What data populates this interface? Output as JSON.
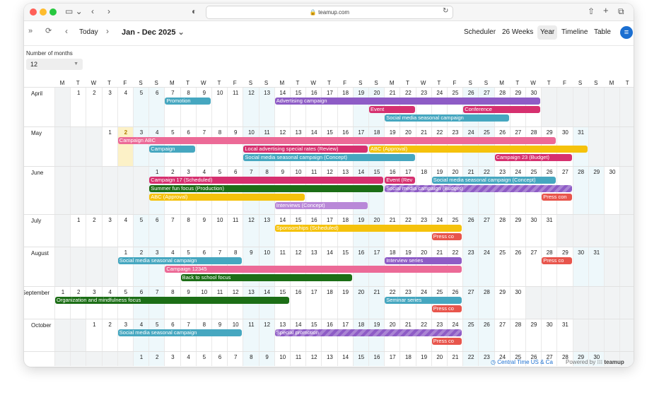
{
  "browser": {
    "url": "teamup.com"
  },
  "toolbar": {
    "today": "Today",
    "range_title": "Jan - Dec 2025",
    "views": [
      "Scheduler",
      "26 Weeks",
      "Year",
      "Timeline",
      "Table"
    ],
    "active_view": "Year"
  },
  "filters": {
    "label": "Number of months",
    "value": "12"
  },
  "weekday_header": [
    "M",
    "T",
    "W",
    "T",
    "F",
    "S",
    "S",
    "M",
    "T",
    "W",
    "T",
    "F",
    "S",
    "S",
    "M",
    "T",
    "W",
    "T",
    "F",
    "S",
    "S",
    "M",
    "T",
    "W",
    "T",
    "F",
    "S",
    "S",
    "M",
    "T",
    "W",
    "T",
    "F",
    "S",
    "S",
    "M",
    "T"
  ],
  "colors": {
    "violet": "#8e5cc6",
    "teal": "#46a7c0",
    "magenta": "#d6306f",
    "pink": "#ec6a97",
    "yellow": "#f5c20c",
    "green": "#1c6e16",
    "lilac": "#b988d8",
    "red": "#e8554c"
  },
  "months": [
    {
      "name": "April",
      "offset": 1,
      "days": 30,
      "height": 56,
      "events": [
        {
          "text": "Promotion",
          "start": 7,
          "end": 9,
          "lane": 0,
          "color": "teal"
        },
        {
          "text": "Advertising campaign",
          "start": 14,
          "end": 30,
          "lane": 0,
          "color": "violet"
        },
        {
          "text": "Event",
          "start": 20,
          "end": 22,
          "lane": 1,
          "color": "magenta"
        },
        {
          "text": "Conference",
          "start": 26,
          "end": 30,
          "lane": 1,
          "color": "magenta"
        },
        {
          "text": "Social media seasonal campaign",
          "start": 21,
          "end": 28,
          "lane": 2,
          "color": "teal"
        }
      ]
    },
    {
      "name": "May",
      "offset": 3,
      "days": 31,
      "height": 56,
      "today": 2,
      "events": [
        {
          "text": "Campaign ABC",
          "start": 2,
          "end": 29,
          "lane": 0,
          "color": "pink"
        },
        {
          "text": "Campaign",
          "start": 4,
          "end": 6,
          "lane": 1,
          "color": "teal"
        },
        {
          "text": "Local advertising special rates (Review)",
          "start": 10,
          "end": 17,
          "lane": 1,
          "color": "magenta"
        },
        {
          "text": "ABC (Approval)",
          "start": 18,
          "end": 31,
          "lane": 1,
          "color": "yellow"
        },
        {
          "text": "Social media seasonal campaign (Concept)",
          "start": 10,
          "end": 20,
          "lane": 2,
          "color": "teal"
        },
        {
          "text": "Campaign 23 (Budget)",
          "start": 26,
          "end": 30,
          "lane": 2,
          "color": "magenta"
        }
      ]
    },
    {
      "name": "June",
      "offset": 6,
      "days": 30,
      "height": 68,
      "events": [
        {
          "text": "Campaign 17 (Scheduled)",
          "start": 1,
          "end": 15,
          "lane": 0,
          "color": "magenta"
        },
        {
          "text": "Event (Rev",
          "start": 16,
          "end": 17,
          "lane": 0,
          "color": "magenta"
        },
        {
          "text": "Social media seasonal campaign (Concept)",
          "start": 19,
          "end": 26,
          "lane": 0,
          "color": "teal"
        },
        {
          "text": "Summer fun focus (Production)",
          "start": 1,
          "end": 15,
          "lane": 1,
          "color": "green"
        },
        {
          "text": "Social media campaign (Budget)",
          "start": 16,
          "end": 27,
          "lane": 1,
          "color": "violet",
          "stripe": true
        },
        {
          "text": "ABC (Approval)",
          "start": 1,
          "end": 10,
          "lane": 2,
          "color": "yellow"
        },
        {
          "text": "Press con",
          "start": 26,
          "end": 27,
          "lane": 2,
          "color": "red"
        },
        {
          "text": "Interviews (Concept)",
          "start": 9,
          "end": 14,
          "lane": 3,
          "color": "lilac"
        }
      ]
    },
    {
      "name": "July",
      "offset": 1,
      "days": 31,
      "height": 46,
      "events": [
        {
          "text": "Sponsorships (Scheduled)",
          "start": 14,
          "end": 25,
          "lane": 0,
          "color": "yellow"
        },
        {
          "text": "Press co",
          "start": 24,
          "end": 25,
          "lane": 1,
          "color": "red"
        }
      ]
    },
    {
      "name": "August",
      "offset": 4,
      "days": 31,
      "height": 56,
      "events": [
        {
          "text": "Social media seasonal campaign",
          "start": 1,
          "end": 8,
          "lane": 0,
          "color": "teal"
        },
        {
          "text": "Interview series",
          "start": 18,
          "end": 22,
          "lane": 0,
          "color": "violet"
        },
        {
          "text": "Press co",
          "start": 28,
          "end": 29,
          "lane": 0,
          "color": "red"
        },
        {
          "text": "Campaign 12345",
          "start": 4,
          "end": 22,
          "lane": 1,
          "color": "pink"
        },
        {
          "text": "Back to school focus",
          "start": 5,
          "end": 15,
          "lane": 2,
          "color": "green"
        }
      ]
    },
    {
      "name": "September",
      "offset": 0,
      "days": 30,
      "height": 46,
      "events": [
        {
          "text": "Organization and mindfulness focus",
          "start": 1,
          "end": 15,
          "lane": 0,
          "color": "green"
        },
        {
          "text": "Seminar series",
          "start": 22,
          "end": 26,
          "lane": 0,
          "color": "teal"
        },
        {
          "text": "Press co",
          "start": 25,
          "end": 26,
          "lane": 1,
          "color": "red"
        }
      ]
    },
    {
      "name": "October",
      "offset": 2,
      "days": 31,
      "height": 46,
      "events": [
        {
          "text": "Social media seasonal campaign",
          "start": 3,
          "end": 10,
          "lane": 0,
          "color": "teal"
        },
        {
          "text": "Special promotion",
          "start": 13,
          "end": 24,
          "lane": 0,
          "color": "violet",
          "stripe": true
        },
        {
          "text": "Press co",
          "start": 23,
          "end": 24,
          "lane": 1,
          "color": "red"
        }
      ]
    },
    {
      "name": "",
      "offset": 5,
      "days": 30,
      "height": 20,
      "events": []
    }
  ],
  "footer": {
    "timezone": "Central Time US & Ca",
    "powered_by": "Powered by",
    "brand": "teamup"
  }
}
